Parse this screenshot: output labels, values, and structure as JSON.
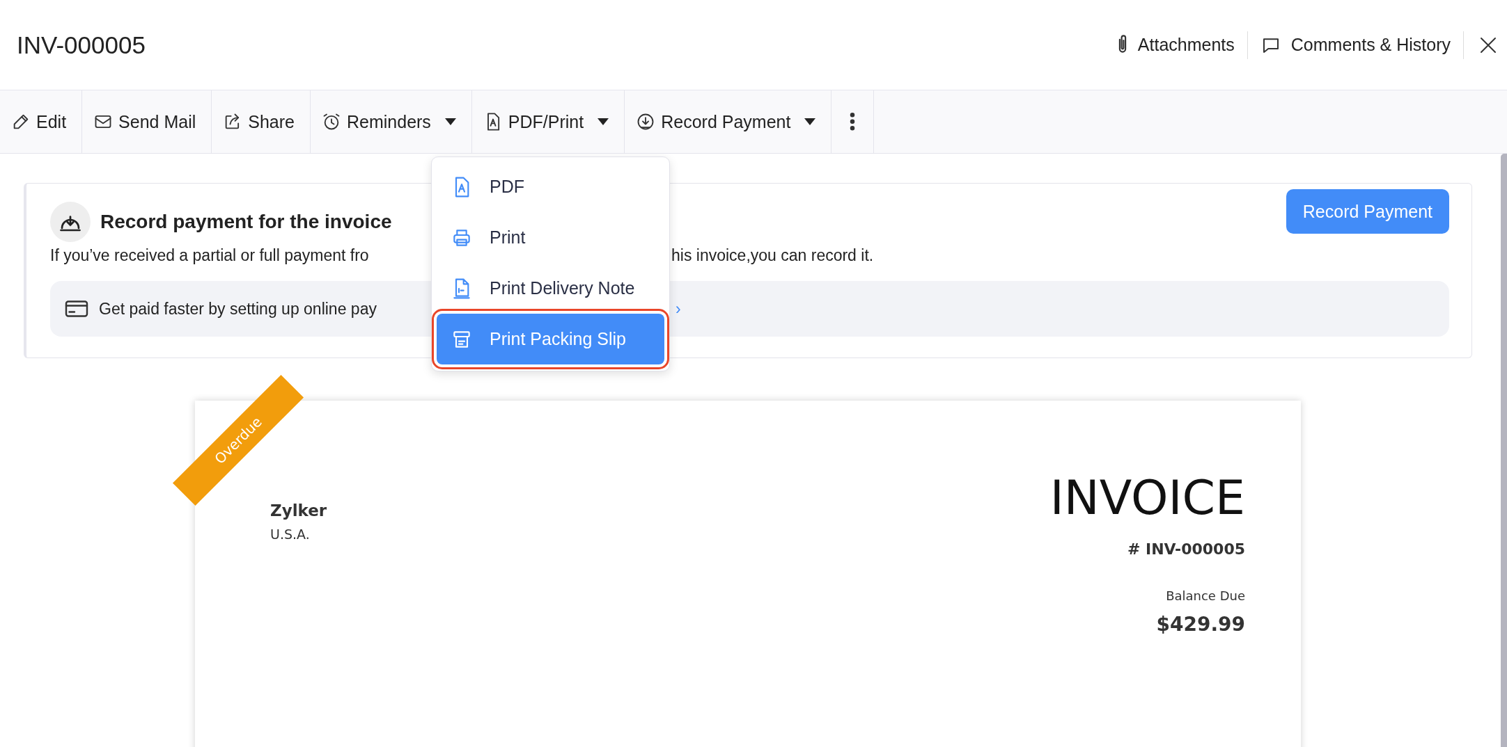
{
  "header": {
    "title": "INV-000005",
    "links": [
      {
        "label": "Attachments"
      },
      {
        "label": "Comments & History"
      }
    ]
  },
  "toolbar": {
    "buttons": [
      {
        "label": "Edit",
        "dropdown": false
      },
      {
        "label": "Send Mail",
        "dropdown": false
      },
      {
        "label": "Share",
        "dropdown": false
      },
      {
        "label": "Reminders",
        "dropdown": true
      },
      {
        "label": "PDF/Print",
        "dropdown": true
      },
      {
        "label": "Record Payment",
        "dropdown": true
      }
    ]
  },
  "menu": {
    "items": [
      {
        "label": "PDF",
        "selected": false,
        "outlined": false
      },
      {
        "label": "Print",
        "selected": false,
        "outlined": false
      },
      {
        "label": "Print Delivery Note",
        "selected": false,
        "outlined": false
      },
      {
        "label": "Print Packing Slip",
        "selected": true,
        "outlined": true
      }
    ]
  },
  "banner": {
    "title": "Record payment for the invoice",
    "text_parts": [
      "If you’ve received a partial or full payment fro",
      "his invoice,you can record it."
    ],
    "button": "Record Payment",
    "promo": {
      "text": "Get paid faster by setting up online pay",
      "link": "›"
    }
  },
  "invoice": {
    "ribbon": "Overdue",
    "org_name": "Zylker",
    "org_country": "U.S.A.",
    "heading": "INVOICE",
    "number": "# INV-000005",
    "balance_label": "Balance Due",
    "balance": "$429.99"
  }
}
